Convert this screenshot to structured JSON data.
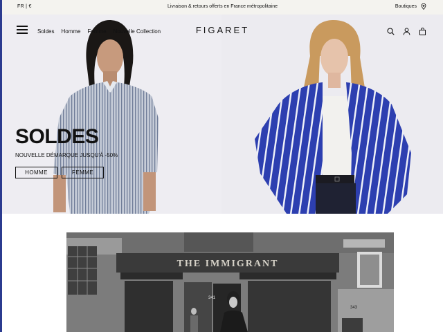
{
  "topbar": {
    "locale": "FR | €",
    "promo": "Livraison & retours offerts en France métropolitaine",
    "stores_label": "Boutiques",
    "stores_icon": "location-pin-icon"
  },
  "nav": {
    "menu_icon": "hamburger-icon",
    "links": [
      "Soldes",
      "Homme",
      "Femme",
      "Nouvelle Collection"
    ],
    "logo": "FIGARET",
    "icons": [
      "search-icon",
      "account-icon",
      "bag-icon"
    ]
  },
  "hero": {
    "title": "SOLDES",
    "subtitle": "Nouvelle démarque jusqu'à -50%",
    "cta_homme": "HOMME",
    "cta_femme": "FEMME"
  },
  "storefront": {
    "sign_text": "THE IMMIGRANT",
    "door_number": "341",
    "building_number": "343"
  },
  "colors": {
    "topbar_bg": "#f4f3ef",
    "accent_blue": "#2d3fb0",
    "text": "#111111"
  }
}
